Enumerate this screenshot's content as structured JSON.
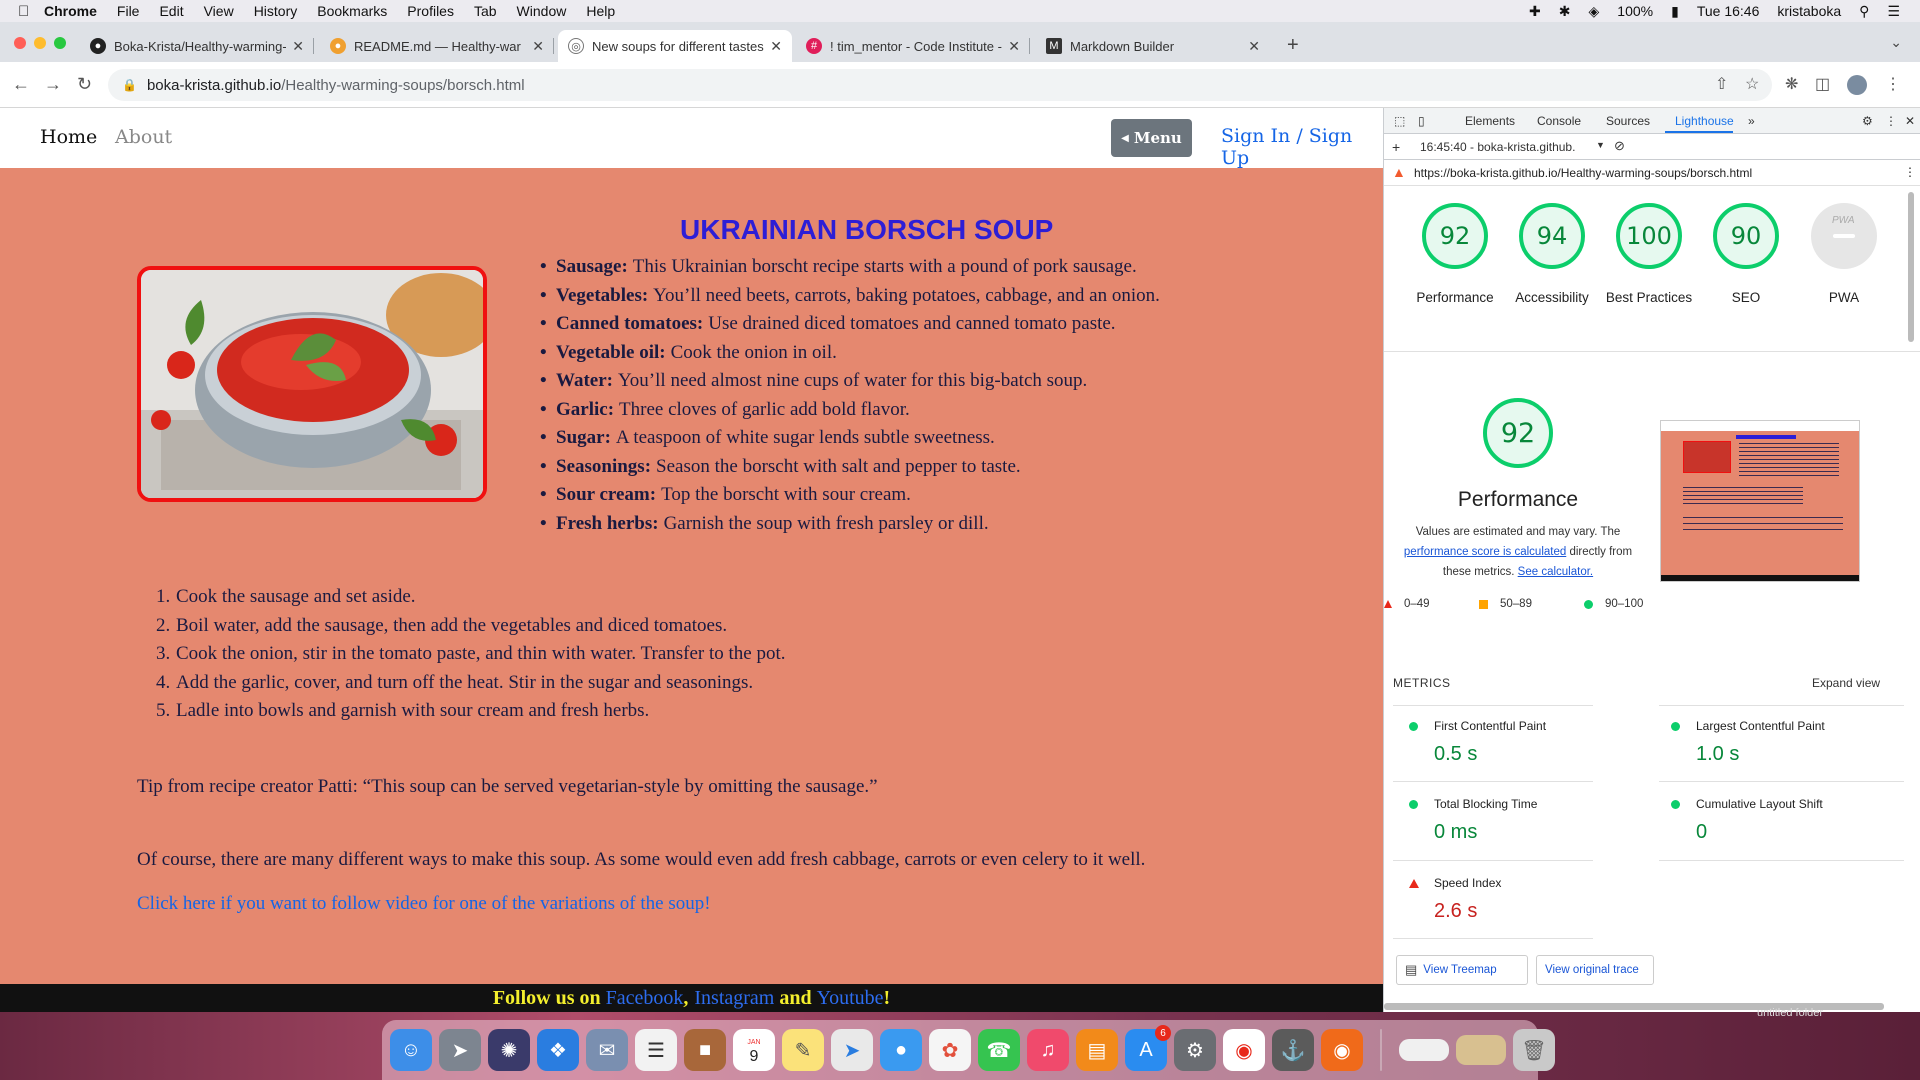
{
  "menubar": {
    "app": "Chrome",
    "items": [
      "File",
      "Edit",
      "View",
      "History",
      "Bookmarks",
      "Profiles",
      "Tab",
      "Window",
      "Help"
    ],
    "battery": "100%",
    "clock": "Tue 16:46",
    "user": "kristaboka"
  },
  "tabs": [
    {
      "label": "Boka-Krista/Healthy-warming-"
    },
    {
      "label": "README.md — Healthy-war"
    },
    {
      "label": "New soups for different tastes"
    },
    {
      "label": "! tim_mentor - Code Institute -"
    },
    {
      "label": "Markdown Builder"
    }
  ],
  "address": {
    "host": "boka-krista.github.io",
    "path": "/Healthy-warming-soups/borsch.html"
  },
  "site": {
    "nav_home": "Home",
    "nav_about": "About",
    "menu_button": "Menu",
    "signin": "Sign In / Sign Up",
    "title": "UKRAINIAN BORSCH SOUP",
    "ingredients": [
      {
        "name": "Sausage:",
        "text": "This Ukrainian borscht recipe starts with a pound of pork sausage."
      },
      {
        "name": "Vegetables:",
        "text": "You’ll need beets, carrots, baking potatoes, cabbage, and an onion."
      },
      {
        "name": "Canned tomatoes:",
        "text": "Use drained diced tomatoes and canned tomato paste."
      },
      {
        "name": "Vegetable oil:",
        "text": "Cook the onion in oil."
      },
      {
        "name": "Water:",
        "text": "You’ll need almost nine cups of water for this big-batch soup."
      },
      {
        "name": "Garlic:",
        "text": "Three cloves of garlic add bold flavor."
      },
      {
        "name": "Sugar:",
        "text": "A teaspoon of white sugar lends subtle sweetness."
      },
      {
        "name": "Seasonings:",
        "text": "Season the borscht with salt and pepper to taste."
      },
      {
        "name": "Sour cream:",
        "text": "Top the borscht with sour cream."
      },
      {
        "name": "Fresh herbs:",
        "text": "Garnish the soup with fresh parsley or dill."
      }
    ],
    "steps": [
      {
        "num": "1.",
        "text": "Cook the sausage and set aside."
      },
      {
        "num": "2.",
        "text": "Boil water, add the sausage, then add the vegetables and diced tomatoes."
      },
      {
        "num": "3.",
        "text": "Cook the onion, stir in the tomato paste, and thin with water. Transfer to the pot."
      },
      {
        "num": "4.",
        "text": "Add the garlic, cover, and turn off the heat. Stir in the sugar and seasonings."
      },
      {
        "num": "5.",
        "text": "Ladle into bowls and garnish with sour cream and fresh herbs."
      }
    ],
    "tip": "Tip from recipe creator Patti: “This soup can be served vegetarian-style by omitting the sausage.”",
    "ofcourse": "Of course, there are many different ways to make this soup. As some would even add fresh cabbage, carrots or even celery to it well.",
    "video_link": "Click here if you want to follow video for one of the variations of the soup!",
    "footer": {
      "prefix": "Follow us on ",
      "facebook": "Facebook",
      "comma": ",",
      "instagram": "Instagram",
      "and": " and ",
      "youtube": "Youtube",
      "bang": "!"
    }
  },
  "devtools": {
    "tabs": [
      "Elements",
      "Console",
      "Sources",
      "Lighthouse"
    ],
    "report_select": "16:45:40 - boka-krista.github.",
    "url": "https://boka-krista.github.io/Healthy-warming-soups/borsch.html",
    "scores": [
      {
        "value": "92",
        "label": "Performance"
      },
      {
        "value": "94",
        "label": "Accessibility"
      },
      {
        "value": "100",
        "label": "Best Practices"
      },
      {
        "value": "90",
        "label": "SEO"
      }
    ],
    "pwa_label": "PWA",
    "perf_score": "92",
    "perf_title": "Performance",
    "perf_desc_1": "Values are estimated and may vary. The",
    "perf_desc_link": "performance score is calculated",
    "perf_desc_2": " directly from",
    "perf_desc_3": "these metrics. ",
    "perf_desc_calc": "See calculator.",
    "legend": [
      "0–49",
      "50–89",
      "90–100"
    ],
    "metrics_header": "METRICS",
    "expand_view": "Expand view",
    "metrics": [
      {
        "label": "First Contentful Paint",
        "value": "0.5 s"
      },
      {
        "label": "Largest Contentful Paint",
        "value": "1.0 s"
      },
      {
        "label": "Total Blocking Time",
        "value": "0 ms"
      },
      {
        "label": "Cumulative Layout Shift",
        "value": "0"
      },
      {
        "label": "Speed Index",
        "value": "2.6 s"
      }
    ],
    "view_treemap": "View Treemap",
    "view_trace": "View original trace"
  },
  "desktop": {
    "folder": "untitled folder",
    "calendar_day": "9",
    "calendar_month": "JAN",
    "appstore_badge": "6"
  },
  "colors": {
    "page_bg": "#e5886f",
    "title": "#2d1ed6",
    "pass": "#0cce6b",
    "fail": "#e8291b",
    "average": "#ffa400"
  }
}
